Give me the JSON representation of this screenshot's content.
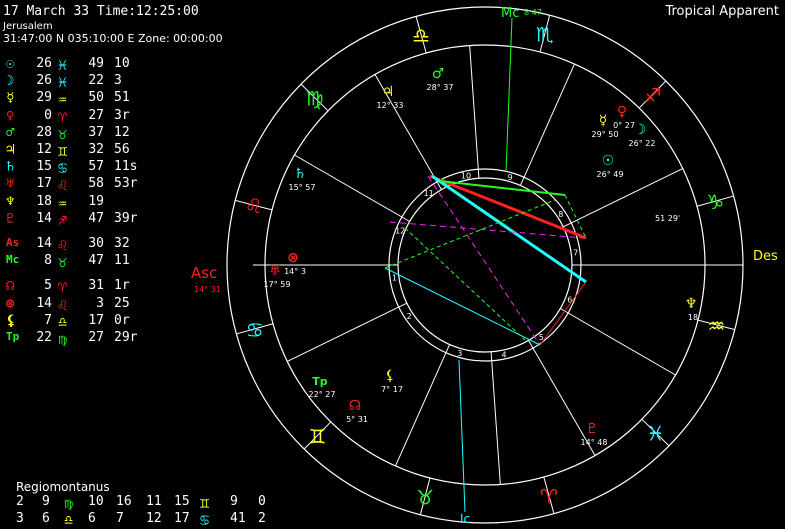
{
  "header": {
    "date_time": "17 March 33  Time:12:25:00",
    "location": "Jerusalem",
    "coords": "31:47:00 N 035:10:00 E  Zone: 00:00:00",
    "system": "Tropical Apparent"
  },
  "colors": {
    "fire": "#ff2020",
    "earth": "#20ff20",
    "air": "#ffff20",
    "water": "#20ffff",
    "ring": "#ffffff"
  },
  "planets": [
    {
      "glyph": "☉",
      "name": "sun-icon",
      "color": "#20ffff",
      "deg": "26",
      "sign": "♓",
      "signColor": "#20ffff",
      "min": "49",
      "sec": "10"
    },
    {
      "glyph": "☽",
      "name": "moon-icon",
      "color": "#20ffff",
      "deg": "26",
      "sign": "♓",
      "signColor": "#20ffff",
      "min": "22",
      "sec": "3"
    },
    {
      "glyph": "☿",
      "name": "mercury-icon",
      "color": "#ffff20",
      "deg": "29",
      "sign": "♒",
      "signColor": "#ffff20",
      "min": "50",
      "sec": "51"
    },
    {
      "glyph": "♀",
      "name": "venus-icon",
      "color": "#ff2020",
      "deg": "0",
      "sign": "♈",
      "signColor": "#ff2020",
      "min": "27",
      "sec": "3r"
    },
    {
      "glyph": "♂",
      "name": "mars-icon",
      "color": "#20ff20",
      "deg": "28",
      "sign": "♉",
      "signColor": "#20ff20",
      "min": "37",
      "sec": "12"
    },
    {
      "glyph": "♃",
      "name": "jupiter-icon",
      "color": "#ffff20",
      "deg": "12",
      "sign": "♊",
      "signColor": "#ffff20",
      "min": "32",
      "sec": "56"
    },
    {
      "glyph": "♄",
      "name": "saturn-icon",
      "color": "#20ffff",
      "deg": "15",
      "sign": "♋",
      "signColor": "#20ffff",
      "min": "57",
      "sec": "11s"
    },
    {
      "glyph": "♅",
      "name": "uranus-icon",
      "color": "#ff2020",
      "deg": "17",
      "sign": "♌",
      "signColor": "#ff2020",
      "min": "58",
      "sec": "53r"
    },
    {
      "glyph": "♆",
      "name": "neptune-icon",
      "color": "#ffff20",
      "deg": "18",
      "sign": "♒",
      "signColor": "#ffff20",
      "min": "19",
      "sec": ""
    },
    {
      "glyph": "♇",
      "name": "pluto-icon",
      "color": "#ff2020",
      "deg": "14",
      "sign": "♐",
      "signColor": "#ff2020",
      "min": "47",
      "sec": "39r"
    },
    {
      "glyph": "As",
      "name": "ascendant-label",
      "color": "#ff2020",
      "deg": "14",
      "sign": "♌",
      "signColor": "#ff2020",
      "min": "30",
      "sec": "32"
    },
    {
      "glyph": "Mc",
      "name": "midheaven-label",
      "color": "#20ff20",
      "deg": "8",
      "sign": "♉",
      "signColor": "#20ff20",
      "min": "47",
      "sec": "11"
    },
    {
      "glyph": "☊",
      "name": "node-icon",
      "color": "#ff2020",
      "deg": "5",
      "sign": "♈",
      "signColor": "#ff2020",
      "min": "31",
      "sec": "1r"
    },
    {
      "glyph": "⊗",
      "name": "fortune-icon",
      "color": "#ff2020",
      "deg": "14",
      "sign": "♌",
      "signColor": "#ff2020",
      "min": "3",
      "sec": "25"
    },
    {
      "glyph": "⚸",
      "name": "lilith-icon",
      "color": "#ffff20",
      "deg": "7",
      "sign": "♎",
      "signColor": "#ffff20",
      "min": "17",
      "sec": "0r"
    },
    {
      "glyph": "Tp",
      "name": "tp-label",
      "color": "#20ff20",
      "deg": "22",
      "sign": "♍",
      "signColor": "#20ff20",
      "min": "27",
      "sec": "29r"
    }
  ],
  "houses": {
    "title": "Regiomontanus",
    "rows": [
      {
        "a": "2",
        "b": "9",
        "s1": "♍",
        "s1c": "#20ff20",
        "c": "10",
        "d": "16",
        "e": "11",
        "f": "15",
        "s2": "♊",
        "s2c": "#ffff20",
        "g": "9",
        "h": "0"
      },
      {
        "a": "3",
        "b": "6",
        "s1": "♎",
        "s1c": "#ffff20",
        "c": "6",
        "d": "7",
        "e": "12",
        "f": "17",
        "s2": "♋",
        "s2c": "#20ffff",
        "g": "41",
        "h": "2"
      }
    ]
  },
  "wheel": {
    "asc_label": "Asc",
    "asc_pos": "14° 31",
    "des_label": "Des",
    "mc_label": "Mc",
    "mc_pos": "8 47",
    "ic_label": "Ic",
    "house_numbers": [
      "1",
      "2",
      "3",
      "4",
      "5",
      "6",
      "7",
      "8",
      "9",
      "10",
      "11",
      "12"
    ],
    "zodiac": [
      {
        "glyph": "♌",
        "name": "leo-icon",
        "color": "#ff2020"
      },
      {
        "glyph": "♋",
        "name": "cancer-icon",
        "color": "#20ffff"
      },
      {
        "glyph": "♊",
        "name": "gemini-icon",
        "color": "#ffff20"
      },
      {
        "glyph": "♉",
        "name": "taurus-icon",
        "color": "#20ff20"
      },
      {
        "glyph": "♈",
        "name": "aries-icon",
        "color": "#ff2020"
      },
      {
        "glyph": "♓",
        "name": "pisces-icon",
        "color": "#20ffff"
      },
      {
        "glyph": "♒",
        "name": "aquarius-icon",
        "color": "#ffff20"
      },
      {
        "glyph": "♑",
        "name": "capricorn-icon",
        "color": "#20ff20"
      },
      {
        "glyph": "♐",
        "name": "sagittarius-icon",
        "color": "#ff2020"
      },
      {
        "glyph": "♏",
        "name": "scorpio-icon",
        "color": "#20ffff"
      },
      {
        "glyph": "♎",
        "name": "libra-icon",
        "color": "#ffff20"
      },
      {
        "glyph": "♍",
        "name": "virgo-icon",
        "color": "#20ff20"
      }
    ],
    "planet_labels": [
      {
        "glyph": "♂",
        "name": "wheel-mars-icon",
        "color": "#20ff20",
        "deg": "28",
        "min": "37"
      },
      {
        "glyph": "♃",
        "name": "wheel-jupiter-icon",
        "color": "#ffff20",
        "deg": "12",
        "min": "33"
      },
      {
        "glyph": "♄",
        "name": "wheel-saturn-icon",
        "color": "#20ffff",
        "deg": "15",
        "min": "57"
      },
      {
        "glyph": "♀",
        "name": "wheel-venus-icon",
        "color": "#ff2020",
        "deg": "0",
        "min": "27"
      },
      {
        "glyph": "☿",
        "name": "wheel-mercury-icon",
        "color": "#ffff20",
        "deg": "29",
        "min": "50"
      },
      {
        "glyph": "☽",
        "name": "wheel-moon-icon",
        "color": "#20ffff",
        "deg": "26",
        "min": "22"
      },
      {
        "glyph": "☉",
        "name": "wheel-sun-icon",
        "color": "#20ffff",
        "deg": "26",
        "min": "49"
      },
      {
        "glyph": "⊗",
        "name": "wheel-fortune-icon",
        "color": "#ff2020",
        "deg": "14",
        "min": "3"
      },
      {
        "glyph": "♅",
        "name": "wheel-uranus-icon",
        "color": "#ff2020",
        "deg": "17",
        "min": "59"
      },
      {
        "glyph": "♆",
        "name": "wheel-neptune-icon",
        "color": "#ffff20",
        "deg": "18",
        "min": ""
      },
      {
        "glyph": "♇",
        "name": "wheel-pluto-icon",
        "color": "#ff2020",
        "deg": "14",
        "min": "48"
      },
      {
        "glyph": "Tp",
        "name": "wheel-tp-label",
        "color": "#20ff20",
        "deg": "22",
        "min": "27"
      },
      {
        "glyph": "⚸",
        "name": "wheel-lilith-icon",
        "color": "#ffff20",
        "deg": "7",
        "min": "17"
      },
      {
        "glyph": "☊",
        "name": "wheel-node-icon",
        "color": "#ff2020",
        "deg": "5",
        "min": "31"
      }
    ],
    "cusp_labels": [
      {
        "name": "cusp-label-7",
        "text": "51 29'"
      }
    ]
  }
}
